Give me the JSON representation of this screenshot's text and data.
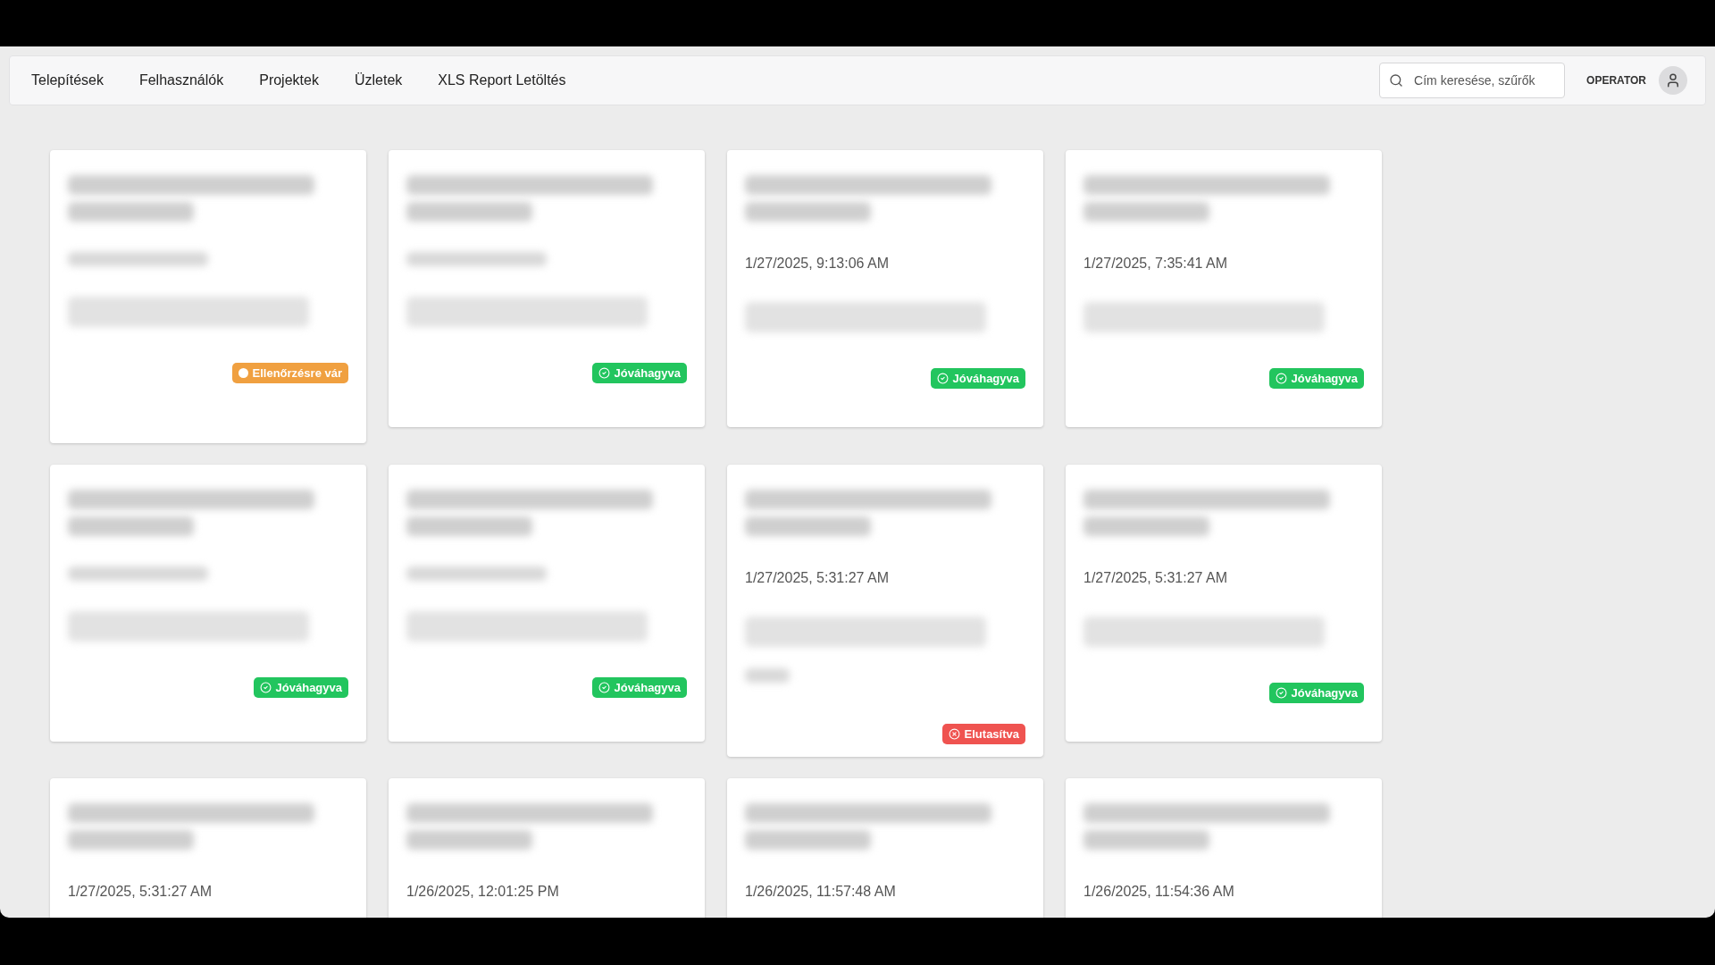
{
  "nav": {
    "links": [
      {
        "label": "Telepítések"
      },
      {
        "label": "Felhasználók"
      },
      {
        "label": "Projektek"
      },
      {
        "label": "Üzletek"
      },
      {
        "label": "XLS Report Letöltés"
      }
    ],
    "search": {
      "placeholder": "Cím keresése, szűrők"
    },
    "user": {
      "role": "OPERATOR"
    }
  },
  "cards": [
    {
      "status": {
        "kind": "pending",
        "label": "Ellenőrzésre vár"
      }
    },
    {
      "status": {
        "kind": "approved",
        "label": "Jóváhagyva"
      }
    },
    {
      "date": "1/27/2025, 9:13:06 AM",
      "status": {
        "kind": "approved",
        "label": "Jóváhagyva"
      }
    },
    {
      "date": "1/27/2025, 7:35:41 AM",
      "status": {
        "kind": "approved",
        "label": "Jóváhagyva"
      }
    },
    {
      "status": {
        "kind": "approved",
        "label": "Jóváhagyva"
      }
    },
    {
      "status": {
        "kind": "approved",
        "label": "Jóváhagyva"
      }
    },
    {
      "date": "1/27/2025, 5:31:27 AM",
      "note_blurred": true,
      "status": {
        "kind": "rejected",
        "label": "Elutasítva"
      }
    },
    {
      "date": "1/27/2025, 5:31:27 AM",
      "status": {
        "kind": "approved",
        "label": "Jóváhagyva"
      }
    },
    {
      "date": "1/27/2025, 5:31:27 AM"
    },
    {
      "date": "1/26/2025, 12:01:25 PM"
    },
    {
      "date": "1/26/2025, 11:57:48 AM"
    },
    {
      "date": "1/26/2025, 11:54:36 AM"
    }
  ]
}
